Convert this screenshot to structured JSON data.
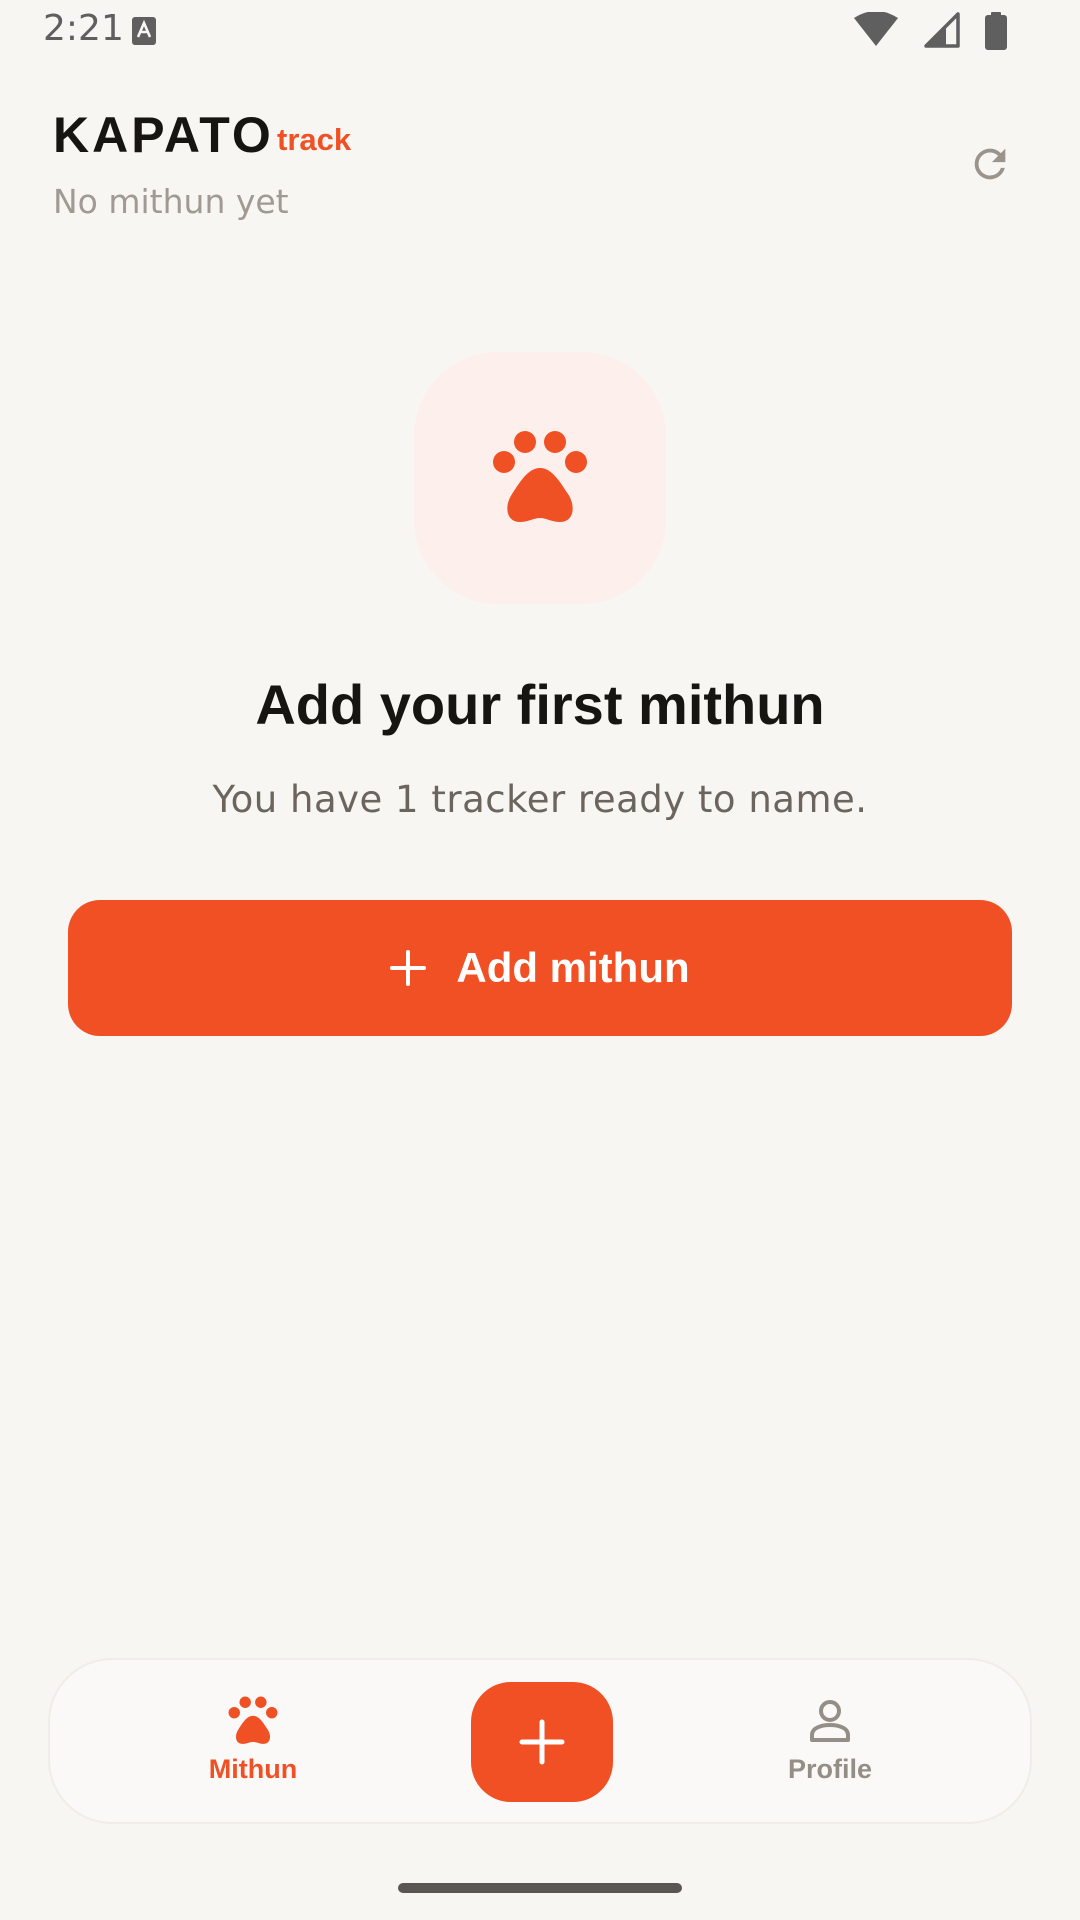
{
  "status_bar": {
    "time": "2:21",
    "icons": [
      "keyboard-a-icon",
      "wifi-icon",
      "cell-signal-icon",
      "battery-icon"
    ]
  },
  "header": {
    "title": "KAPATO",
    "badge": "track",
    "subtitle": "No mithun yet",
    "refresh_icon": "refresh-icon"
  },
  "empty_state": {
    "icon": "paw-icon",
    "title": "Add your first mithun",
    "subtitle": "You have 1 tracker ready to name.",
    "button_label": "Add mithun",
    "button_icon": "plus-icon"
  },
  "bottom_nav": {
    "items": [
      {
        "label": "Mithun",
        "icon": "paw-icon",
        "active": true
      },
      {
        "label": "Profile",
        "icon": "person-icon",
        "active": false
      }
    ],
    "fab_icon": "plus-icon"
  },
  "colors": {
    "accent": "#f05024",
    "background": "#f8f6f3",
    "icon_tile": "#fdefeb",
    "text_primary": "#171512",
    "text_muted": "#a09a92"
  }
}
